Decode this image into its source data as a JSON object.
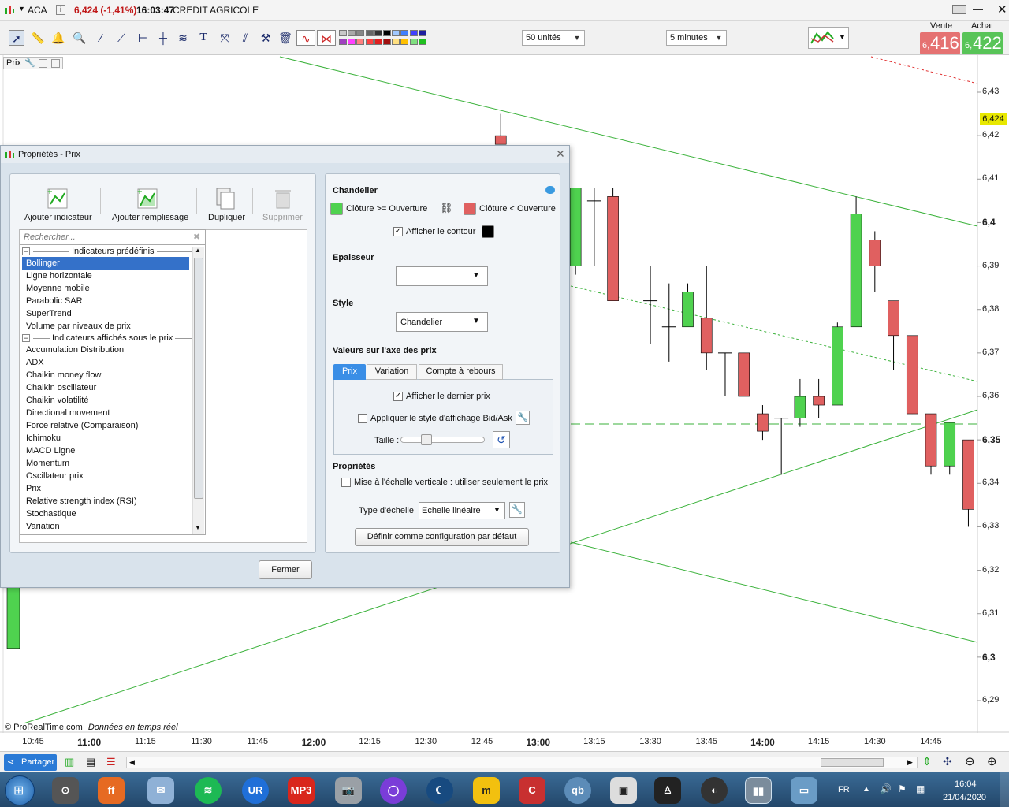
{
  "titlebar": {
    "symbol": "ACA",
    "price_change": "6,424 (-1,41%)",
    "time": "16:03:47",
    "instrument": "CREDIT AGRICOLE"
  },
  "toolbar": {
    "units_select": "50 unités",
    "interval_select": "5 minutes",
    "sell_label": "Vente",
    "buy_label": "Achat",
    "sell_price_small": "6,",
    "sell_price_big": "416",
    "buy_price_small": "6,",
    "buy_price_big": "422",
    "swatch_colors": [
      "#c8c8c8",
      "#aaaaaa",
      "#888888",
      "#666666",
      "#333333",
      "#000000",
      "#a0c8ff",
      "#4080ff",
      "#4040ff",
      "#2020a0",
      "#a040c0",
      "#ff40ff",
      "#ff8080",
      "#ff4040",
      "#e02020",
      "#a01010",
      "#ffe080",
      "#ffc000",
      "#80e080",
      "#20c020"
    ]
  },
  "chart": {
    "panel_label": "Prix",
    "current_price": "6,424",
    "price_labels": [
      "6,43",
      "6,42",
      "6,41",
      "6,4",
      "6,39",
      "6,38",
      "6,37",
      "6,36",
      "6,35",
      "6,34",
      "6,33",
      "6,32",
      "6,31",
      "6,3",
      "6,29"
    ],
    "bold_price_labels": [
      "6,4",
      "6,35",
      "6,3"
    ],
    "time_labels": [
      "10:45",
      "11:00",
      "11:15",
      "11:30",
      "11:45",
      "12:00",
      "12:15",
      "12:30",
      "12:45",
      "13:00",
      "13:15",
      "13:30",
      "13:45",
      "14:00",
      "14:15",
      "14:30",
      "14:45"
    ],
    "bold_time_labels": [
      "11:00",
      "12:00",
      "13:00",
      "14:00"
    ],
    "copyright": "© ProRealTime.com",
    "realtime_note": "Données en temps réel",
    "up_color": "#4fd24f",
    "down_color": "#e06060"
  },
  "chart_data": {
    "type": "candlestick",
    "y_range": [
      6.285,
      6.44
    ],
    "x_labels": [
      "10:45",
      "11:00",
      "11:15",
      "11:30",
      "11:45",
      "12:00",
      "12:15",
      "12:30",
      "12:45",
      "13:00",
      "13:15",
      "13:30",
      "13:45",
      "14:00",
      "14:15",
      "14:30",
      "14:45"
    ],
    "candles": [
      {
        "t": "12:50",
        "open": 6.42,
        "close": 6.418,
        "high": 6.425,
        "low": 6.418
      },
      {
        "t": "13:05",
        "open": 6.386,
        "close": 6.386,
        "high": 6.388,
        "low": 6.368
      },
      {
        "t": "13:10",
        "open": 6.39,
        "close": 6.408,
        "high": 6.408,
        "low": 6.388
      },
      {
        "t": "13:15",
        "open": 6.405,
        "close": 6.405,
        "high": 6.408,
        "low": 6.39
      },
      {
        "t": "13:20",
        "open": 6.406,
        "close": 6.382,
        "high": 6.408,
        "low": 6.382
      },
      {
        "t": "13:30",
        "open": 6.382,
        "close": 6.382,
        "high": 6.39,
        "low": 6.372
      },
      {
        "t": "13:35",
        "open": 6.376,
        "close": 6.376,
        "high": 6.386,
        "low": 6.368
      },
      {
        "t": "13:40",
        "open": 6.376,
        "close": 6.384,
        "high": 6.386,
        "low": 6.376
      },
      {
        "t": "13:45",
        "open": 6.378,
        "close": 6.37,
        "high": 6.39,
        "low": 6.366
      },
      {
        "t": "13:50",
        "open": 6.37,
        "close": 6.37,
        "high": 6.37,
        "low": 6.36
      },
      {
        "t": "13:55",
        "open": 6.37,
        "close": 6.36,
        "high": 6.37,
        "low": 6.36
      },
      {
        "t": "14:00",
        "open": 6.356,
        "close": 6.352,
        "high": 6.358,
        "low": 6.35
      },
      {
        "t": "14:05",
        "open": 6.355,
        "close": 6.355,
        "high": 6.355,
        "low": 6.342
      },
      {
        "t": "14:10",
        "open": 6.355,
        "close": 6.36,
        "high": 6.364,
        "low": 6.353
      },
      {
        "t": "14:15",
        "open": 6.36,
        "close": 6.358,
        "high": 6.364,
        "low": 6.355
      },
      {
        "t": "14:20",
        "open": 6.358,
        "close": 6.376,
        "high": 6.377,
        "low": 6.358
      },
      {
        "t": "14:25",
        "open": 6.376,
        "close": 6.402,
        "high": 6.406,
        "low": 6.376
      },
      {
        "t": "14:30",
        "open": 6.396,
        "close": 6.39,
        "high": 6.398,
        "low": 6.384
      },
      {
        "t": "14:35",
        "open": 6.382,
        "close": 6.374,
        "high": 6.382,
        "low": 6.366
      },
      {
        "t": "14:40",
        "open": 6.374,
        "close": 6.356,
        "high": 6.374,
        "low": 6.356
      },
      {
        "t": "14:45",
        "open": 6.356,
        "close": 6.344,
        "high": 6.356,
        "low": 6.342
      },
      {
        "t": "14:50",
        "open": 6.344,
        "close": 6.354,
        "high": 6.354,
        "low": 6.342
      },
      {
        "t": "14:55",
        "open": 6.35,
        "close": 6.334,
        "high": 6.35,
        "low": 6.33
      }
    ],
    "xlabel": "",
    "ylabel": ""
  },
  "dialog": {
    "title": "Propriétés - Prix",
    "tools": [
      "Ajouter indicateur",
      "Ajouter remplissage",
      "Dupliquer",
      "Supprimer"
    ],
    "search_placeholder": "Rechercher...",
    "group1": "Indicateurs prédéfinis",
    "group1_items": [
      "Bollinger",
      "Ligne horizontale",
      "Moyenne mobile",
      "Parabolic SAR",
      "SuperTrend",
      "Volume par niveaux de prix"
    ],
    "group2": "Indicateurs affichés sous le prix",
    "group2_items": [
      "Accumulation Distribution",
      "ADX",
      "Chaikin money flow",
      "Chaikin oscillateur",
      "Chaikin volatilité",
      "Directional movement",
      "Force relative (Comparaison)",
      "Ichimoku",
      "MACD Ligne",
      "Momentum",
      "Oscillateur prix",
      "Prix",
      "Relative strength index (RSI)",
      "Stochastique",
      "Variation"
    ],
    "right": {
      "chandelier": "Chandelier",
      "up_label": "Clôture >= Ouverture",
      "down_label": "Clôture < Ouverture",
      "show_outline": "Afficher le contour",
      "epaisseur": "Epaisseur",
      "style": "Style",
      "style_value": "Chandelier",
      "axis_values": "Valeurs sur l'axe des prix",
      "tabs": [
        "Prix",
        "Variation",
        "Compte à rebours"
      ],
      "show_last_price": "Afficher le dernier prix",
      "apply_bidask": "Appliquer le style d'affichage Bid/Ask",
      "size": "Taille :",
      "proprietes": "Propriétés",
      "vertical_scale": "Mise à l'échelle verticale : utiliser seulement le prix",
      "scale_type": "Type d'échelle",
      "scale_value": "Echelle linéaire",
      "default_btn": "Définir comme configuration par défaut"
    },
    "close_btn": "Fermer"
  },
  "bottombar": {
    "share": "Partager"
  },
  "taskbar": {
    "lang": "FR",
    "time": "16:04",
    "date": "21/04/2020"
  }
}
